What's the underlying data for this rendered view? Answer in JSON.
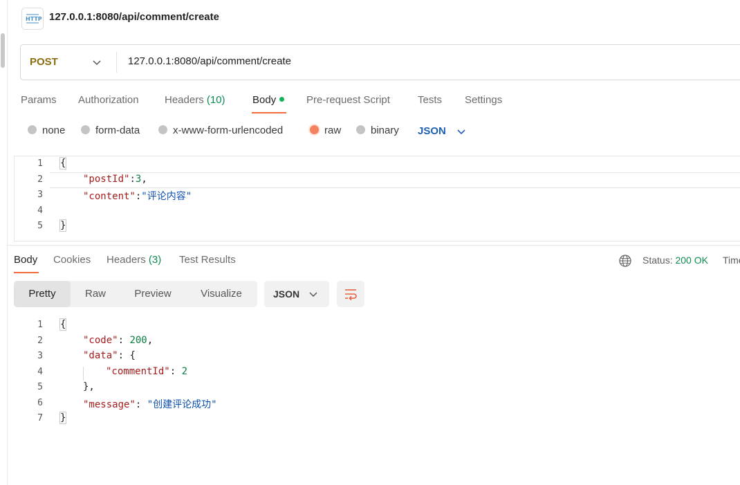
{
  "request": {
    "title": "127.0.0.1:8080/api/comment/create",
    "method": "POST",
    "url": "127.0.0.1:8080/api/comment/create"
  },
  "request_tabs": [
    {
      "label": "Params"
    },
    {
      "label": "Authorization"
    },
    {
      "label": "Headers",
      "count": "(10)"
    },
    {
      "label": "Body"
    },
    {
      "label": "Pre-request Script"
    },
    {
      "label": "Tests"
    },
    {
      "label": "Settings"
    }
  ],
  "body_types": [
    {
      "label": "none"
    },
    {
      "label": "form-data"
    },
    {
      "label": "x-www-form-urlencoded"
    },
    {
      "label": "raw"
    },
    {
      "label": "binary"
    }
  ],
  "body_format": "JSON",
  "request_body": {
    "line_numbers": [
      "1",
      "2",
      "3",
      "4",
      "5"
    ],
    "open": "{",
    "k1": "\"postId\"",
    "v1": "3",
    "c1": ",",
    "k2": "\"content\"",
    "v2": "\"评论内容\"",
    "close": "}",
    "colon": ":"
  },
  "response_tabs": [
    {
      "label": "Body"
    },
    {
      "label": "Cookies"
    },
    {
      "label": "Headers",
      "count": "(3)"
    },
    {
      "label": "Test Results"
    }
  ],
  "status": {
    "label": "Status:",
    "value": "200 OK",
    "time_label": "Time"
  },
  "view_modes": [
    {
      "label": "Pretty"
    },
    {
      "label": "Raw"
    },
    {
      "label": "Preview"
    },
    {
      "label": "Visualize"
    }
  ],
  "response_format": "JSON",
  "response_body": {
    "line_numbers": [
      "1",
      "2",
      "3",
      "4",
      "5",
      "6",
      "7"
    ],
    "open": "{",
    "code_key": "\"code\"",
    "code_val": "200",
    "data_key": "\"data\"",
    "data_open": "{",
    "cid_key": "\"commentId\"",
    "cid_val": "2",
    "data_close": "},",
    "msg_key": "\"message\"",
    "msg_val": "\"创建评论成功\"",
    "close": "}",
    "colon": ": ",
    "comma": ","
  },
  "colors": {
    "accent": "#f26b3a",
    "method": "#8a6d0f",
    "success": "#0e8a50",
    "json_blue": "#1f5fb3"
  },
  "icons": {
    "http": "http-request-icon",
    "method_dropdown": "chevron-down-icon",
    "format_dropdown": "chevron-down-icon",
    "globe": "globe-icon",
    "wrap": "wrap-lines-icon"
  }
}
